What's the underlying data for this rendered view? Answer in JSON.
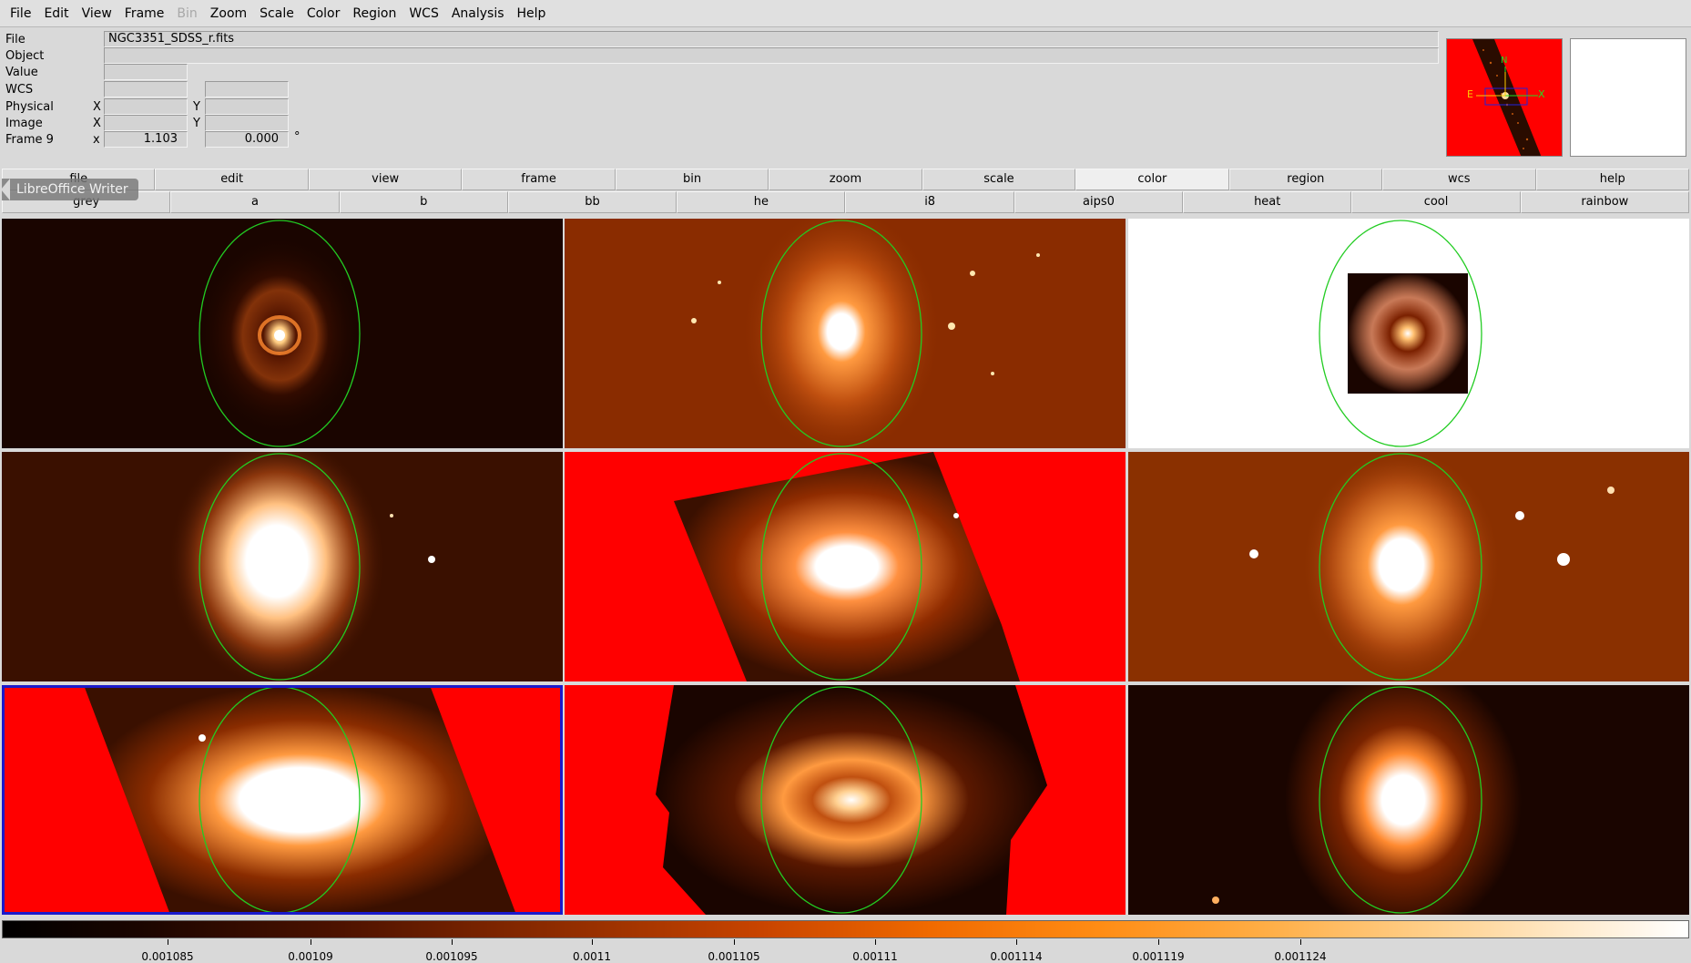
{
  "menu": [
    {
      "label": "File",
      "enabled": true
    },
    {
      "label": "Edit",
      "enabled": true
    },
    {
      "label": "View",
      "enabled": true
    },
    {
      "label": "Frame",
      "enabled": true
    },
    {
      "label": "Bin",
      "enabled": false
    },
    {
      "label": "Zoom",
      "enabled": true
    },
    {
      "label": "Scale",
      "enabled": true
    },
    {
      "label": "Color",
      "enabled": true
    },
    {
      "label": "Region",
      "enabled": true
    },
    {
      "label": "WCS",
      "enabled": true
    },
    {
      "label": "Analysis",
      "enabled": true
    },
    {
      "label": "Help",
      "enabled": true
    }
  ],
  "info": {
    "file_label": "File",
    "file_value": "NGC3351_SDSS_r.fits",
    "object_label": "Object",
    "object_value": "",
    "value_label": "Value",
    "value_value": "",
    "wcs_label": "WCS",
    "physical_label": "Physical",
    "image_label": "Image",
    "frame_label": "Frame 9",
    "x_label": "X",
    "y_label": "Y",
    "frame_x_label": "x",
    "zoom_value": "1.103",
    "angle_value": "0.000",
    "angle_unit": "°"
  },
  "panner": {
    "east_label": "E",
    "x_label": "X",
    "north_label": "N"
  },
  "buttonbar_main": [
    "file",
    "edit",
    "view",
    "frame",
    "bin",
    "zoom",
    "scale",
    "color",
    "region",
    "wcs",
    "help"
  ],
  "buttonbar_main_active": "color",
  "buttonbar_color": [
    "grey",
    "a",
    "b",
    "bb",
    "he",
    "i8",
    "aips0",
    "heat",
    "cool",
    "rainbow"
  ],
  "tooltip": "LibreOffice Writer",
  "colorbar": {
    "colormap": "heat",
    "ticks": [
      "0.001085",
      "0.00109",
      "0.001095",
      "0.0011",
      "0.001105",
      "0.00111",
      "0.001114",
      "0.001119",
      "0.001124"
    ]
  },
  "frames_current_index": 6,
  "colors": {
    "region_ellipse": "#22cc22",
    "blank": "#ff0000",
    "current_frame_border": "#1a1acc"
  }
}
